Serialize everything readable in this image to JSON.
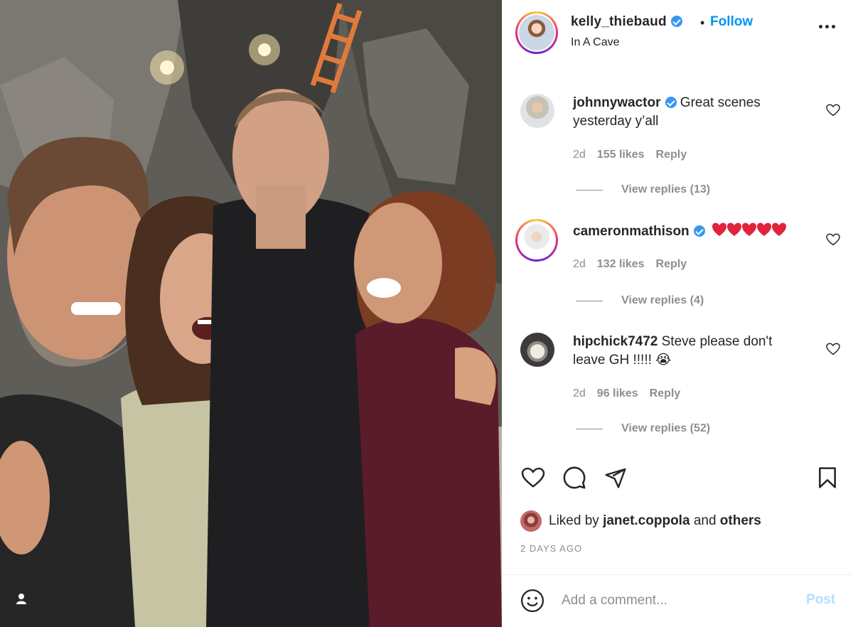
{
  "post": {
    "image_alt": "",
    "tag_icon": "person-tag-icon"
  },
  "header": {
    "username": "kelly_thiebaud",
    "separator": "•",
    "follow_label": "Follow",
    "location": "In A Cave",
    "more_icon": "more-options-icon"
  },
  "comments": [
    {
      "username": "johnnywactor",
      "verified": true,
      "text": "Great scenes yesterday y’all",
      "time": "2d",
      "likes": "155 likes",
      "reply_label": "Reply",
      "view_replies": "View replies (13)"
    },
    {
      "username": "cameronmathison",
      "verified": true,
      "text": "❤️❤️❤️❤️❤️",
      "time": "2d",
      "likes": "132 likes",
      "reply_label": "Reply",
      "view_replies": "View replies (4)"
    },
    {
      "username": "hipchick7472",
      "verified": false,
      "text": "Steve please don't leave GH !!!!! 😭",
      "time": "2d",
      "likes": "96 likes",
      "reply_label": "Reply",
      "view_replies": "View replies (52)"
    }
  ],
  "actions": {
    "like_icon": "heart-icon",
    "comment_icon": "comment-icon",
    "share_icon": "share-icon",
    "save_icon": "bookmark-icon"
  },
  "likes_summary": {
    "prefix": "Liked by",
    "user": "janet.coppola",
    "conjunction": "and",
    "others": "others"
  },
  "post_age": "2 DAYS AGO",
  "comment_box": {
    "placeholder": "Add a comment...",
    "post_label": "Post",
    "emoji_icon": "emoji-icon"
  },
  "colors": {
    "accent": "#0095f6",
    "verified": "#3897f0",
    "muted": "#8e8e8e",
    "post_disabled": "#b2dffc"
  }
}
